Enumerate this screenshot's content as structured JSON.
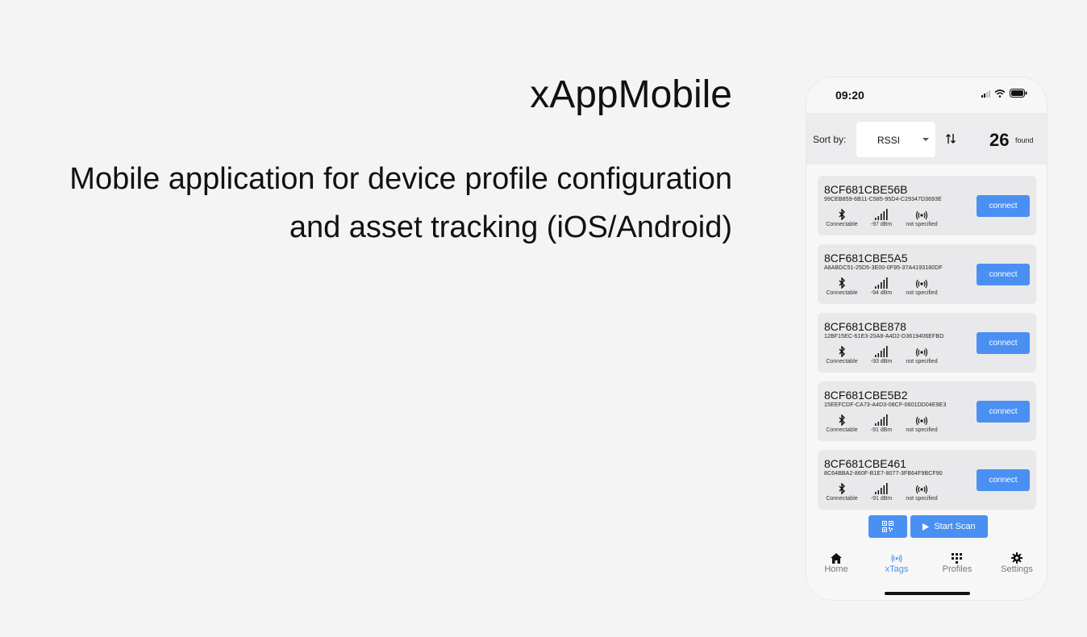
{
  "promo": {
    "title": "xAppMobile",
    "subtitle_line1": "Mobile application for device profile configuration",
    "subtitle_line2": "and asset tracking (iOS/Android)"
  },
  "status_bar": {
    "time": "09:20"
  },
  "sort": {
    "label": "Sort by:",
    "value": "RSSI",
    "found_count": "26",
    "found_label": "found"
  },
  "devices": [
    {
      "name": "8CF681CBE56B",
      "uuid": "99CEB859-6B11-C585-95D4-C29347D3693E",
      "connectable": "Connectable",
      "rssi": "-97 dBm",
      "type": "not specified",
      "button": "connect"
    },
    {
      "name": "8CF681CBE5A5",
      "uuid": "A8ABDC51-25D5-3E00-0F95-37A4193180DF",
      "connectable": "Connectable",
      "rssi": "-94 dBm",
      "type": "not specified",
      "button": "connect"
    },
    {
      "name": "8CF681CBE878",
      "uuid": "12BF15EC-61E3-20A8-A4D2-D3619406EFBD",
      "connectable": "Connectable",
      "rssi": "-93 dBm",
      "type": "not specified",
      "button": "connect"
    },
    {
      "name": "8CF681CBE5B2",
      "uuid": "15EEFCDF-CA73-A4D3-08CF-0601DD04E9E3",
      "connectable": "Connectable",
      "rssi": "-91 dBm",
      "type": "not specified",
      "button": "connect"
    },
    {
      "name": "8CF681CBE461",
      "uuid": "8C64BBA2-860F-B1E7-8077-3FB64F9BCF90",
      "connectable": "Connectable",
      "rssi": "-91 dBm",
      "type": "not specified",
      "button": "connect"
    }
  ],
  "actions": {
    "qr_icon": "qr-code-icon",
    "scan_label": "Start Scan"
  },
  "tabs": [
    {
      "label": "Home",
      "icon": "home-icon",
      "active": false
    },
    {
      "label": "xTags",
      "icon": "broadcast-icon",
      "active": true
    },
    {
      "label": "Profiles",
      "icon": "grid-icon",
      "active": false
    },
    {
      "label": "Settings",
      "icon": "gear-icon",
      "active": false
    }
  ],
  "colors": {
    "accent": "#4a90f2",
    "background": "#f4f4f5",
    "card": "#e9e9eb"
  }
}
